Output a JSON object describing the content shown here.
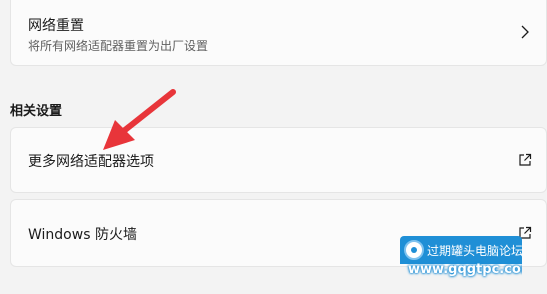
{
  "network_reset": {
    "title": "网络重置",
    "subtitle": "将所有网络适配器重置为出厂设置",
    "icon": "chevron-right-icon"
  },
  "related_settings": {
    "heading": "相关设置",
    "items": [
      {
        "label": "更多网络适配器选项",
        "icon": "external-link-icon"
      },
      {
        "label": "Windows 防火墙",
        "icon": "external-link-icon"
      }
    ]
  },
  "annotation": {
    "icon": "red-arrow-icon",
    "color": "#e8353a"
  },
  "watermark": {
    "title": "过期罐头电脑论坛",
    "url": "www.gqgtpc.com",
    "color": "#1f8fd6"
  }
}
